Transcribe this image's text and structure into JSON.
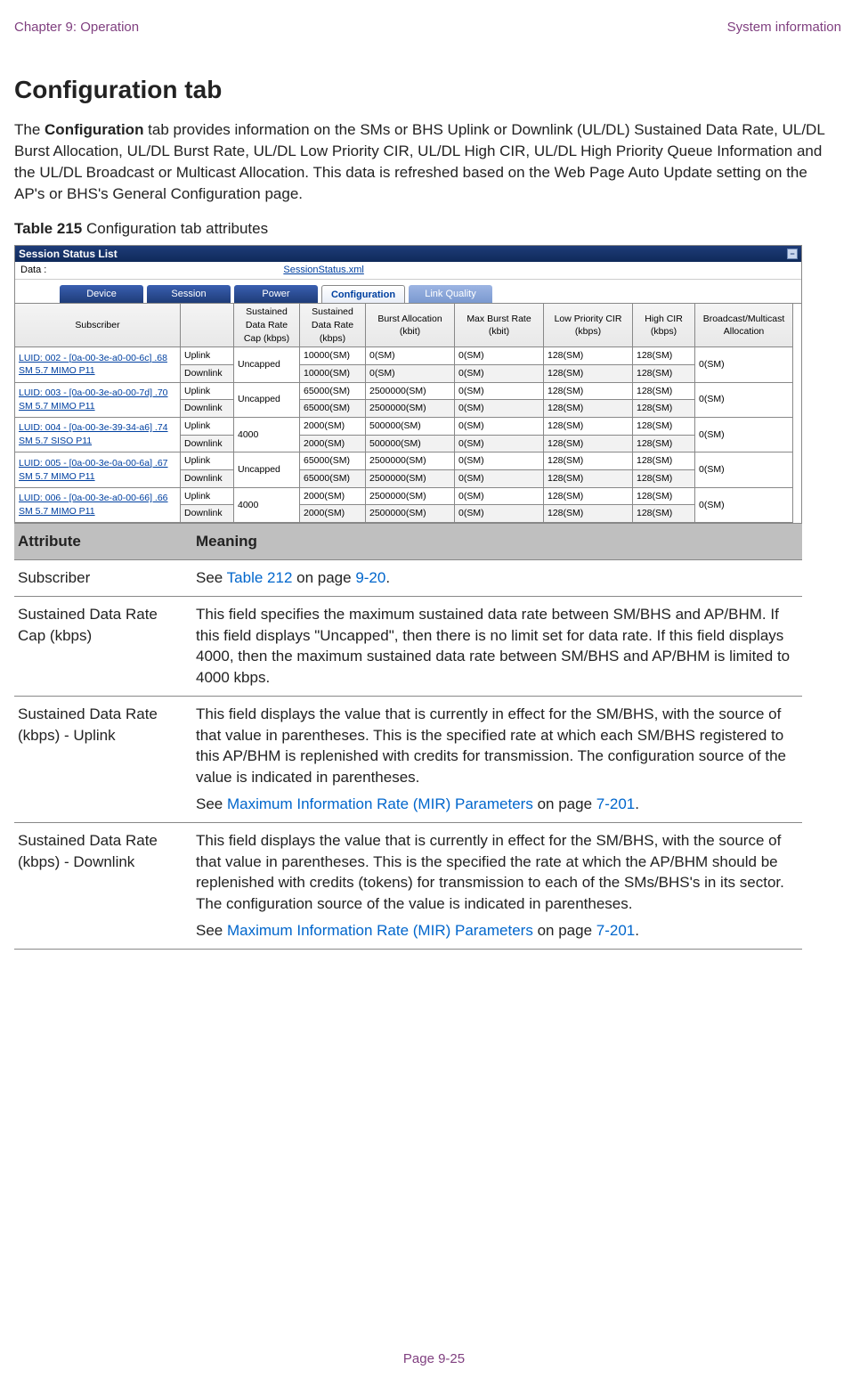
{
  "header": {
    "left": "Chapter 9:  Operation",
    "right": "System information"
  },
  "title": "Configuration tab",
  "intro_parts": {
    "a": "The ",
    "b": "Configuration",
    "c": " tab provides information on the SMs or BHS Uplink or Downlink (UL/DL) Sustained Data Rate, UL/DL Burst Allocation, UL/DL Burst Rate, UL/DL Low Priority CIR, UL/DL High CIR, UL/DL High Priority Queue Information and the UL/DL Broadcast or Multicast Allocation. This data is refreshed based on the Web Page Auto Update setting on the AP's or BHS's General Configuration page."
  },
  "table_label": {
    "bold": "Table 215",
    "rest": " Configuration tab attributes"
  },
  "figure": {
    "titlebar": "Session Status List",
    "data_label": "Data :",
    "data_link": "SessionStatus.xml",
    "tabs": [
      "Device",
      "Session",
      "Power",
      "Configuration",
      "Link Quality"
    ],
    "columns": [
      "Subscriber",
      "",
      "Sustained Data Rate Cap (kbps)",
      "Sustained Data Rate (kbps)",
      "Burst Allocation (kbit)",
      "Max Burst Rate (kbit)",
      "Low Priority CIR (kbps)",
      "High CIR (kbps)",
      "Broadcast/Multicast Allocation"
    ],
    "rows": [
      {
        "sub": "LUID: 002 - [0a-00-3e-a0-00-6c] .68 SM 5.7 MIMO P11",
        "cap": "Uncapped",
        "u": {
          "dir": "Uplink",
          "sdr": "10000(SM)",
          "ba": "0(SM)",
          "mbr": "0(SM)",
          "lcir": "128(SM)",
          "hcir": "128(SM)"
        },
        "d": {
          "dir": "Downlink",
          "sdr": "10000(SM)",
          "ba": "0(SM)",
          "mbr": "0(SM)",
          "lcir": "128(SM)",
          "hcir": "128(SM)"
        },
        "bma": "0(SM)"
      },
      {
        "sub": "LUID: 003 - [0a-00-3e-a0-00-7d] .70 SM 5.7 MIMO P11",
        "cap": "Uncapped",
        "u": {
          "dir": "Uplink",
          "sdr": "65000(SM)",
          "ba": "2500000(SM)",
          "mbr": "0(SM)",
          "lcir": "128(SM)",
          "hcir": "128(SM)"
        },
        "d": {
          "dir": "Downlink",
          "sdr": "65000(SM)",
          "ba": "2500000(SM)",
          "mbr": "0(SM)",
          "lcir": "128(SM)",
          "hcir": "128(SM)"
        },
        "bma": "0(SM)"
      },
      {
        "sub": "LUID: 004 - [0a-00-3e-39-34-a6] .74 SM 5.7 SISO P11",
        "cap": "4000",
        "u": {
          "dir": "Uplink",
          "sdr": "2000(SM)",
          "ba": "500000(SM)",
          "mbr": "0(SM)",
          "lcir": "128(SM)",
          "hcir": "128(SM)"
        },
        "d": {
          "dir": "Downlink",
          "sdr": "2000(SM)",
          "ba": "500000(SM)",
          "mbr": "0(SM)",
          "lcir": "128(SM)",
          "hcir": "128(SM)"
        },
        "bma": "0(SM)"
      },
      {
        "sub": "LUID: 005 - [0a-00-3e-0a-00-6a] .67 SM 5.7 MIMO P11",
        "cap": "Uncapped",
        "u": {
          "dir": "Uplink",
          "sdr": "65000(SM)",
          "ba": "2500000(SM)",
          "mbr": "0(SM)",
          "lcir": "128(SM)",
          "hcir": "128(SM)"
        },
        "d": {
          "dir": "Downlink",
          "sdr": "65000(SM)",
          "ba": "2500000(SM)",
          "mbr": "0(SM)",
          "lcir": "128(SM)",
          "hcir": "128(SM)"
        },
        "bma": "0(SM)"
      },
      {
        "sub": "LUID: 006 - [0a-00-3e-a0-00-66] .66 SM 5.7 MIMO P11",
        "cap": "4000",
        "u": {
          "dir": "Uplink",
          "sdr": "2000(SM)",
          "ba": "2500000(SM)",
          "mbr": "0(SM)",
          "lcir": "128(SM)",
          "hcir": "128(SM)"
        },
        "d": {
          "dir": "Downlink",
          "sdr": "2000(SM)",
          "ba": "2500000(SM)",
          "mbr": "0(SM)",
          "lcir": "128(SM)",
          "hcir": "128(SM)"
        },
        "bma": "0(SM)"
      }
    ]
  },
  "attr_table": {
    "head": {
      "a": "Attribute",
      "m": "Meaning"
    },
    "rows": [
      {
        "a": "Subscriber",
        "m_pre": "See ",
        "m_link": "Table 212",
        "m_mid": " on page ",
        "m_link2": "9-20",
        "m_post": "."
      },
      {
        "a": "Sustained Data Rate Cap (kbps)",
        "m": "This field specifies the maximum sustained data rate between SM/BHS and AP/BHM. If this field displays \"Uncapped\", then there is no limit set for data rate. If this field displays 4000, then the maximum sustained data rate between SM/BHS and AP/BHM is limited to 4000 kbps."
      },
      {
        "a": "Sustained Data Rate (kbps) - Uplink",
        "m": "This field displays the value that is currently in effect for the SM/BHS, with the source of that value in parentheses. This is the specified rate at which each SM/BHS registered to this AP/BHM is replenished with credits for transmission. The configuration source of the value is indicated in parentheses.",
        "m2_pre": "See ",
        "m2_link": "Maximum Information Rate (MIR) Parameters",
        "m2_mid": " on page ",
        "m2_link2": "7-201",
        "m2_post": "."
      },
      {
        "a": "Sustained Data Rate (kbps) - Downlink",
        "m": "This field displays the value that is currently in effect for the SM/BHS, with the source of that value in parentheses. This is the specified the rate at which the AP/BHM should be replenished with credits (tokens) for transmission to each of the SMs/BHS's in its sector. The configuration source of the value is indicated in parentheses.",
        "m2_pre": "See ",
        "m2_link": "Maximum Information Rate (MIR) Parameters",
        "m2_mid": " on page ",
        "m2_link2": "7-201",
        "m2_post": "."
      }
    ]
  },
  "footer": "Page 9-25"
}
